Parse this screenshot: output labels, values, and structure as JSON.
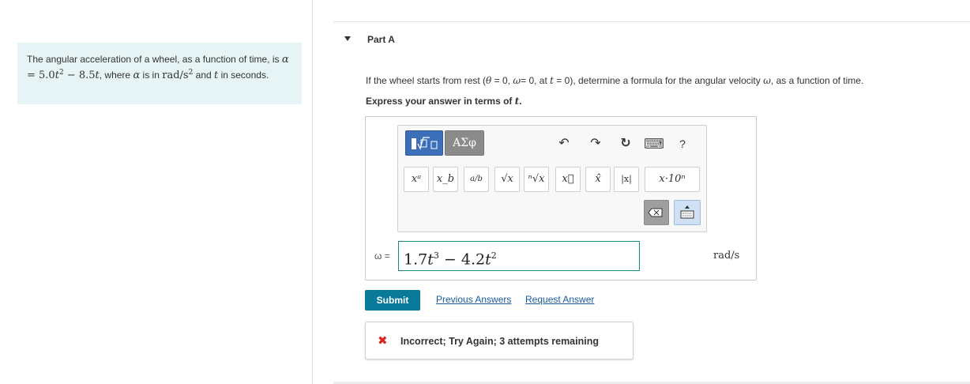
{
  "problem": {
    "text_1": "The angular acceleration of a wheel, as a function of time, is ",
    "alpha": "α",
    "eq": " = 5.0",
    "t1": "t",
    "pow2": "2",
    "minus": " − 8.5",
    "t2": "t",
    "text_2": ", where ",
    "alpha2": "α",
    "text_3": " is in ",
    "unit": "rad/s",
    "unit_pow": "2",
    "text_4": " and ",
    "t3": "t",
    "text_5": " in seconds."
  },
  "part": {
    "title": "Part A"
  },
  "question": {
    "text_1": "If the wheel starts from rest (",
    "theta": "θ",
    "text_2": " = 0, ",
    "omega": "ω",
    "text_3": "= 0, at ",
    "t": "t",
    "text_4": " = 0), determine a formula for the angular velocity ",
    "omega2": "ω",
    "text_5": ", as a function of time."
  },
  "express": {
    "text": "Express your answer in terms of ",
    "var": "t",
    "end": "."
  },
  "toolbar": {
    "greek_label": "ΑΣφ",
    "undo_icon": "↶",
    "redo_icon": "↷",
    "reset_icon": "↻",
    "keyboard_icon": "⌨",
    "help_label": "?",
    "symbols": [
      "xᵃ",
      "x_b",
      "a/b",
      "√x",
      "ⁿ√x",
      "x⃗",
      "x̂",
      "|x|",
      "x·10ⁿ"
    ]
  },
  "answer": {
    "label": "ω =",
    "value_coef1": "1.7",
    "value_var1": "t",
    "value_pow1": "3",
    "value_minus": " − 4.2",
    "value_var2": "t",
    "value_pow2": "2",
    "units": "rad/s"
  },
  "actions": {
    "submit": "Submit",
    "previous": "Previous Answers",
    "request": "Request Answer"
  },
  "feedback": {
    "icon": "✖",
    "text": "Incorrect; Try Again; 3 attempts remaining"
  },
  "colors": {
    "problem_bg": "#e6f4f6",
    "submit_bg": "#0a7a9a",
    "link": "#1a5aa0",
    "error": "#d9261c",
    "template_btn": "#3d6fb8",
    "input_border": "#1a8a85"
  }
}
